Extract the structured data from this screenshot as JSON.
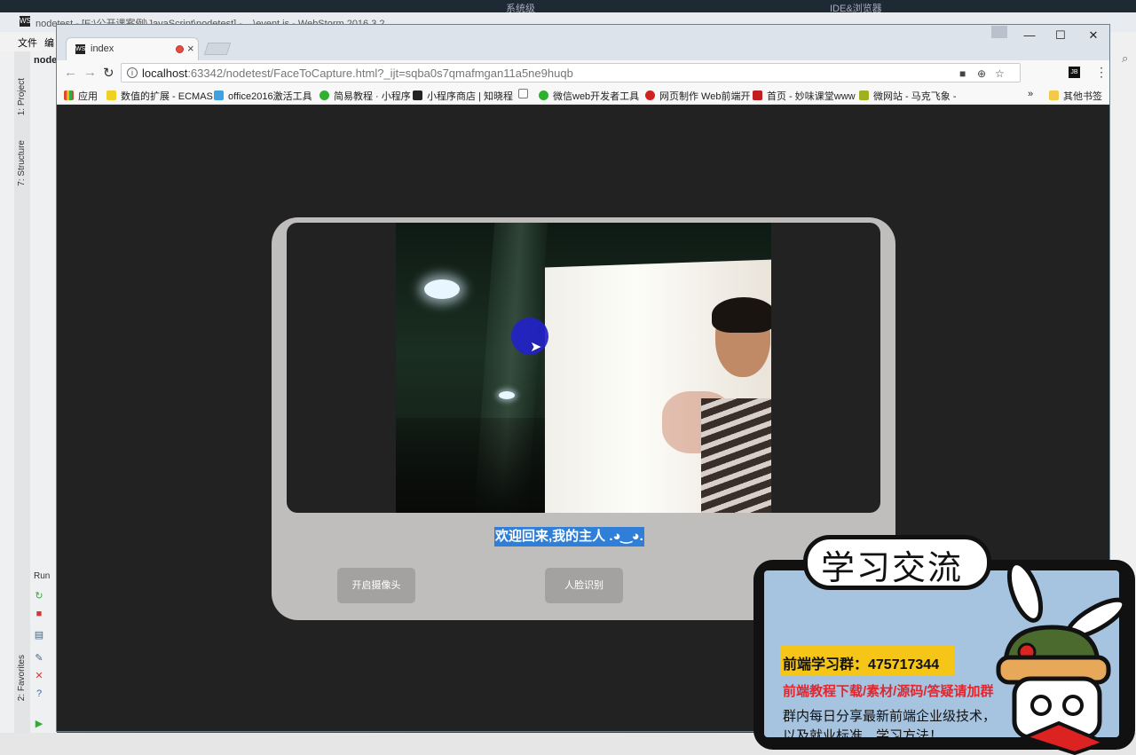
{
  "desktop": {
    "top_labels": [
      "系统级",
      "IDE&浏览器"
    ],
    "ide_title": "nodetest - [E:\\公开课案例\\JavaScript\\nodetest] - ...\\event.js - WebStorm 2016.3.2",
    "ide_menu": [
      "文件",
      "编"
    ],
    "ide_side_tabs": [
      "1: Project",
      "7: Structure",
      "2: Favorites"
    ],
    "ide_run_label": "Run",
    "ide_project_label": "node"
  },
  "browser": {
    "tab_title": "index",
    "url_host": "localhost",
    "url_rest": ":63342/nodetest/FaceToCapture.html?_ijt=sqba0s7qmafmgan11a5ne9huqb",
    "bookmarks": [
      {
        "label": "应用",
        "color": "#e0a030"
      },
      {
        "label": "数值的扩展 - ECMAS",
        "color": "#f0d020"
      },
      {
        "label": "office2016激活工具",
        "color": "#40a0e0"
      },
      {
        "label": "简易教程 · 小程序",
        "color": "#30b030"
      },
      {
        "label": "小程序商店 | 知晓程",
        "color": "#222222"
      },
      {
        "label": "",
        "color": "#ffffff"
      },
      {
        "label": "微信web开发者工具",
        "color": "#30b030"
      },
      {
        "label": "网页制作 Web前端开",
        "color": "#d02020"
      },
      {
        "label": "首页 - 妙味课堂www",
        "color": "#c02020"
      },
      {
        "label": "微网站 - 马克飞象 -",
        "color": "#a0b020"
      }
    ],
    "bookmarks_more": "»",
    "other_bookmarks": "其他书签"
  },
  "page": {
    "welcome": "欢迎回来,我的主人 .◕‿◕.",
    "btn_camera": "开启摄像头",
    "btn_face": "人脸识别"
  },
  "promo": {
    "title": "学习交流",
    "group": "前端学习群：475717344",
    "subtitle": "前端教程下载/素材/源码/答疑请加群",
    "line1": "群内每日分享最新前端企业级技术，",
    "line2": "以及就业标准，学习方法！"
  },
  "colors": {
    "page_bg": "#222222",
    "panel": "#c0bebd",
    "button": "#a3a2a1",
    "highlight": "#2f7ed8",
    "cursor_dot": "#2222c8",
    "promo_bg": "#a6c4e0",
    "promo_yellow": "#f5c518",
    "promo_red": "#e3262d"
  }
}
